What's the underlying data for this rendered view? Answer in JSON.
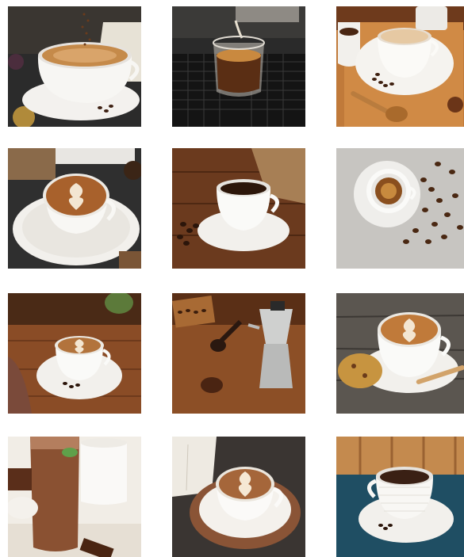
{
  "gallery": {
    "tiles": [
      {
        "subject": "cappuccino-with-cocoa-dust",
        "accent": "#c58a4a"
      },
      {
        "subject": "espresso-machine-pour",
        "accent": "#7a4a22"
      },
      {
        "subject": "latte-cup-on-tray",
        "accent": "#d9a066"
      },
      {
        "subject": "latte-art-cup",
        "accent": "#9c5a2c"
      },
      {
        "subject": "espresso-on-wooden-table",
        "accent": "#3d1f0f"
      },
      {
        "subject": "espresso-with-beans",
        "accent": "#5a3218"
      },
      {
        "subject": "latte-art-on-table",
        "accent": "#8b4e28"
      },
      {
        "subject": "moka-pot-and-beans",
        "accent": "#b8743c"
      },
      {
        "subject": "latte-art-with-cookie",
        "accent": "#b06a2e"
      },
      {
        "subject": "iced-chocolate-drink",
        "accent": "#7c4a2d"
      },
      {
        "subject": "latte-art-with-book",
        "accent": "#caa27a"
      },
      {
        "subject": "espresso-on-blue-table",
        "accent": "#3a2014"
      }
    ]
  }
}
